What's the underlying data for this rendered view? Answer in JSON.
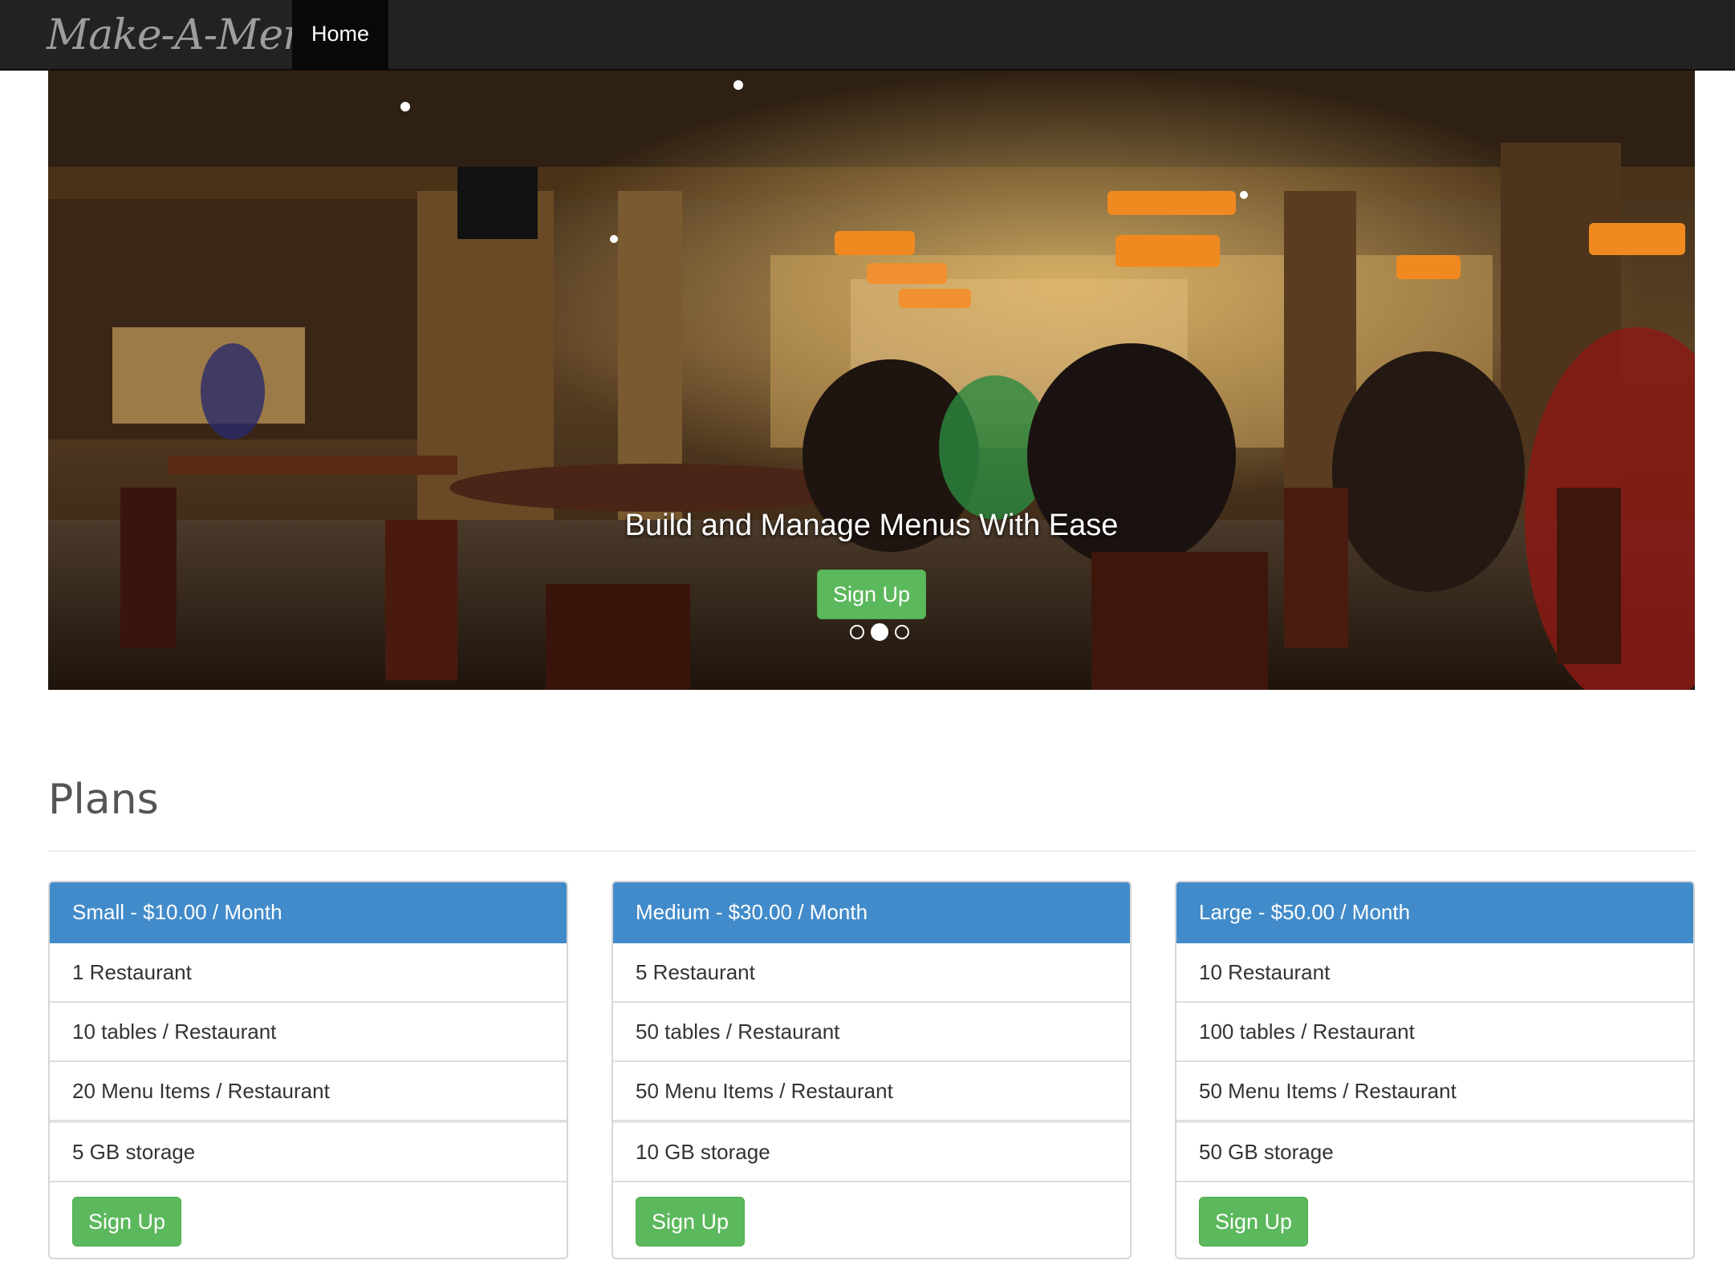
{
  "navbar": {
    "brand": "Make-A-Menu!",
    "home_label": "Home"
  },
  "carousel": {
    "heading": "Build and Manage Menus With Ease",
    "button_label": "Sign Up",
    "slide_count": 3,
    "active_slide": 2,
    "image": "restaurant-interior-photo"
  },
  "plans": {
    "title": "Plans",
    "items": [
      {
        "heading": "Small - $10.00 / Month",
        "features": [
          "1 Restaurant",
          "10 tables / Restaurant",
          "20 Menu Items / Restaurant",
          "5 GB storage"
        ],
        "button_label": "Sign Up"
      },
      {
        "heading": "Medium - $30.00 / Month",
        "features": [
          "5 Restaurant",
          "50 tables / Restaurant",
          "50 Menu Items / Restaurant",
          "10 GB storage"
        ],
        "button_label": "Sign Up"
      },
      {
        "heading": "Large - $50.00 / Month",
        "features": [
          "10 Restaurant",
          "100 tables / Restaurant",
          "50 Menu Items / Restaurant",
          "50 GB storage"
        ],
        "button_label": "Sign Up"
      }
    ]
  },
  "colors": {
    "navbar_bg": "#222222",
    "panel_heading": "#428bca",
    "button_success": "#5cb85c"
  }
}
